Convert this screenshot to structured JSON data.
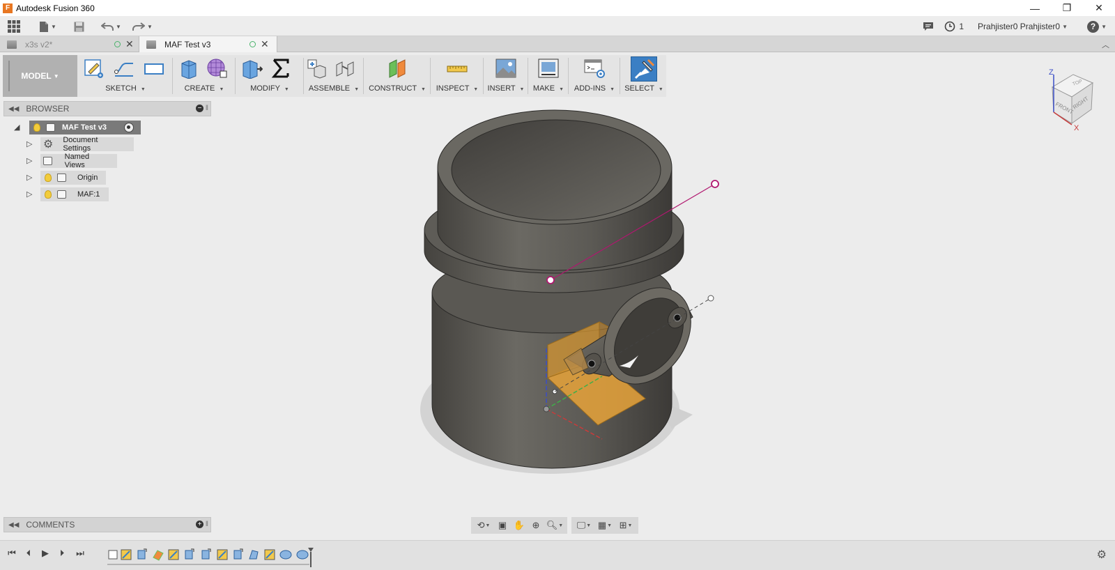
{
  "window": {
    "title": "Autodesk Fusion 360",
    "app_icon": "F",
    "minimize": "—",
    "restore": "❐",
    "close": "✕"
  },
  "toolbar": {
    "grid_icon": "app-grid-icon",
    "jobs_count": "1",
    "user_name": "Prahjister0 Prahjister0",
    "help_label": "?"
  },
  "tabs": [
    {
      "label": "x3s v2*",
      "active": false
    },
    {
      "label": "MAF Test v3",
      "active": true
    }
  ],
  "ribbon": {
    "workspace": "MODEL",
    "groups": [
      {
        "label": "SKETCH"
      },
      {
        "label": "CREATE"
      },
      {
        "label": "MODIFY"
      },
      {
        "label": "ASSEMBLE"
      },
      {
        "label": "CONSTRUCT"
      },
      {
        "label": "INSPECT"
      },
      {
        "label": "INSERT"
      },
      {
        "label": "MAKE"
      },
      {
        "label": "ADD-INS"
      },
      {
        "label": "SELECT"
      }
    ]
  },
  "browser": {
    "title": "BROWSER",
    "root": "MAF Test v3",
    "items": [
      {
        "label": "Document Settings",
        "icon": "gear-icon"
      },
      {
        "label": "Named Views",
        "icon": "folder-icon"
      },
      {
        "label": "Origin",
        "icon": "folder-icon"
      },
      {
        "label": "MAF:1",
        "icon": "component-icon"
      }
    ]
  },
  "comments": {
    "title": "COMMENTS"
  },
  "viewcube": {
    "top": "TOP",
    "front": "FRONT",
    "right": "RIGHT",
    "z": "Z",
    "x": "X"
  },
  "colors": {
    "accent": "#3b7fc4",
    "sketch_line": "#b0176f",
    "plane": "#e8a33a",
    "body": "#5a5852"
  }
}
